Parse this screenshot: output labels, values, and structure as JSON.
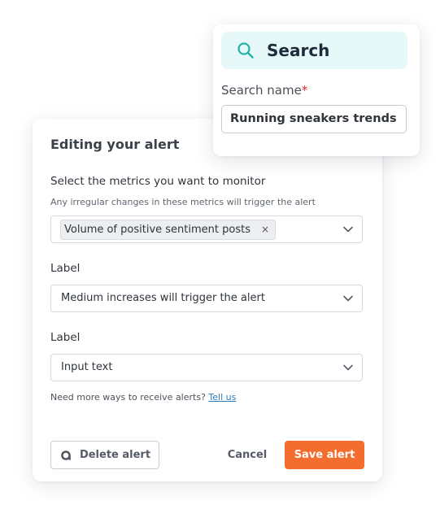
{
  "search_card": {
    "title": "Search",
    "name_label": "Search name",
    "required_mark": "*",
    "name_value": "Running sneakers trends",
    "accent_color": "#1fb5a8"
  },
  "alert": {
    "title": "Editing your alert",
    "metrics": {
      "label": "Select the metrics you want to monitor",
      "help": "Any irregular changes in these metrics will trigger the alert",
      "chip": "Volume of positive sentiment posts",
      "chip_remove": "×"
    },
    "label_one": {
      "label": "Label",
      "value": "Medium increases will trigger the alert"
    },
    "label_two": {
      "label": "Label",
      "value": "Input text"
    },
    "more_ways": "Need more ways to receive alerts?",
    "tell_us": "Tell us",
    "delete_label": "Delete alert",
    "cancel_label": "Cancel",
    "save_label": "Save alert",
    "save_color": "#f36d2e"
  }
}
